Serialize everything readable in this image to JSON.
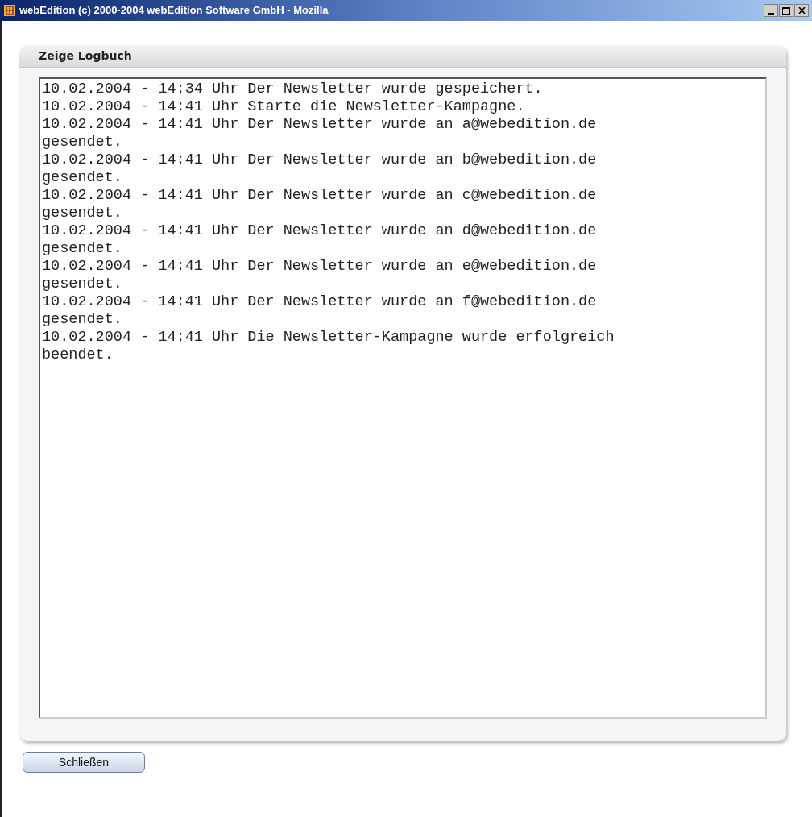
{
  "window": {
    "title": "webEdition (c) 2000-2004 webEdition Software GmbH - Mozilla"
  },
  "panel": {
    "title": "Zeige Logbuch"
  },
  "log": [
    "10.02.2004 - 14:34 Uhr Der Newsletter wurde gespeichert.",
    "10.02.2004 - 14:41 Uhr Starte die Newsletter-Kampagne.",
    "10.02.2004 - 14:41 Uhr Der Newsletter wurde an a@webedition.de gesendet.",
    "10.02.2004 - 14:41 Uhr Der Newsletter wurde an b@webedition.de gesendet.",
    "10.02.2004 - 14:41 Uhr Der Newsletter wurde an c@webedition.de gesendet.",
    "10.02.2004 - 14:41 Uhr Der Newsletter wurde an d@webedition.de gesendet.",
    "10.02.2004 - 14:41 Uhr Der Newsletter wurde an e@webedition.de gesendet.",
    "10.02.2004 - 14:41 Uhr Der Newsletter wurde an f@webedition.de gesendet.",
    "10.02.2004 - 14:41 Uhr Die Newsletter-Kampagne wurde erfolgreich beendet."
  ],
  "buttons": [
    "Schließen"
  ]
}
